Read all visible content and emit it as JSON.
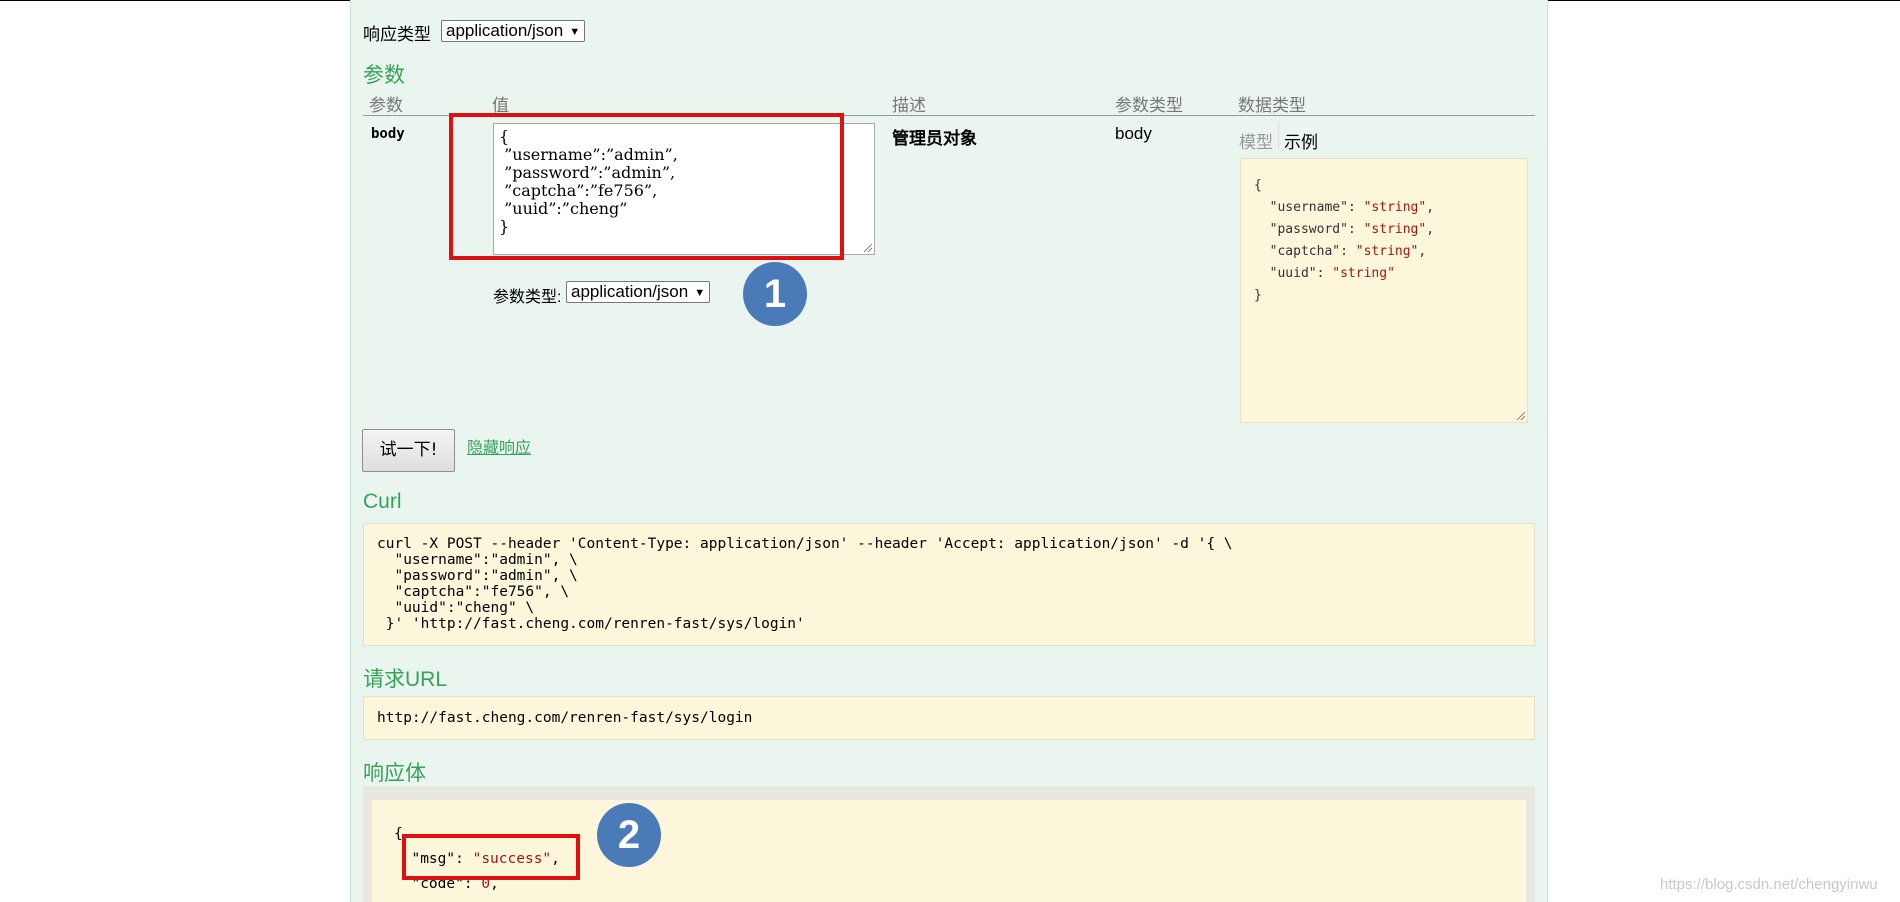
{
  "response_type": {
    "label": "响应类型",
    "value": "application/json"
  },
  "params": {
    "title": "参数",
    "headers": [
      "参数",
      "值",
      "描述",
      "参数类型",
      "数据类型"
    ],
    "row": {
      "name": "body",
      "value_lines": [
        "{",
        " ”username”:”admin”,",
        " ”password”:”admin”,",
        " ”captcha”:”fe756”,",
        " ”uuid”:”cheng”",
        "}"
      ],
      "description": "管理员对象",
      "param_type": "body",
      "content_type_label": "参数类型:",
      "content_type_value": "application/json",
      "tabs": {
        "model": "模型",
        "example": "示例"
      },
      "example": {
        "open": "{",
        "fields": [
          {
            "key": "\"username\"",
            "value": "\"string\"",
            "sep": ","
          },
          {
            "key": "\"password\"",
            "value": "\"string\"",
            "sep": ","
          },
          {
            "key": "\"captcha\"",
            "value": "\"string\"",
            "sep": ","
          },
          {
            "key": "\"uuid\"",
            "value": "\"string\"",
            "sep": ""
          }
        ],
        "close": "}"
      }
    }
  },
  "actions": {
    "try_button": "试一下!",
    "hide_response": "隐藏响应"
  },
  "curl": {
    "title": "Curl",
    "lines": [
      "curl -X POST --header 'Content-Type: application/json' --header 'Accept: application/json' -d '{ \\",
      "  \"username\":\"admin\", \\",
      "  \"password\":\"admin\", \\",
      "  \"captcha\":\"fe756\", \\",
      "  \"uuid\":\"cheng\" \\",
      " }' 'http://fast.cheng.com/renren-fast/sys/login'"
    ]
  },
  "request_url": {
    "title": "请求URL",
    "value": "http://fast.cheng.com/renren-fast/sys/login"
  },
  "response_body": {
    "title": "响应体",
    "open": "{",
    "msg_key": "\"msg\"",
    "msg_value": "\"success\"",
    "code_key": "\"code\"",
    "code_value": "0"
  },
  "annotations": {
    "badge1": "1",
    "badge2": "2"
  },
  "watermark": "https://blog.csdn.net/chengyinwu",
  "colors": {
    "accent": "#34a35a",
    "panel": "#ebf5ef",
    "code_bg": "#fcf6db",
    "highlight": "#e01010",
    "badge": "#4a7ab8"
  }
}
